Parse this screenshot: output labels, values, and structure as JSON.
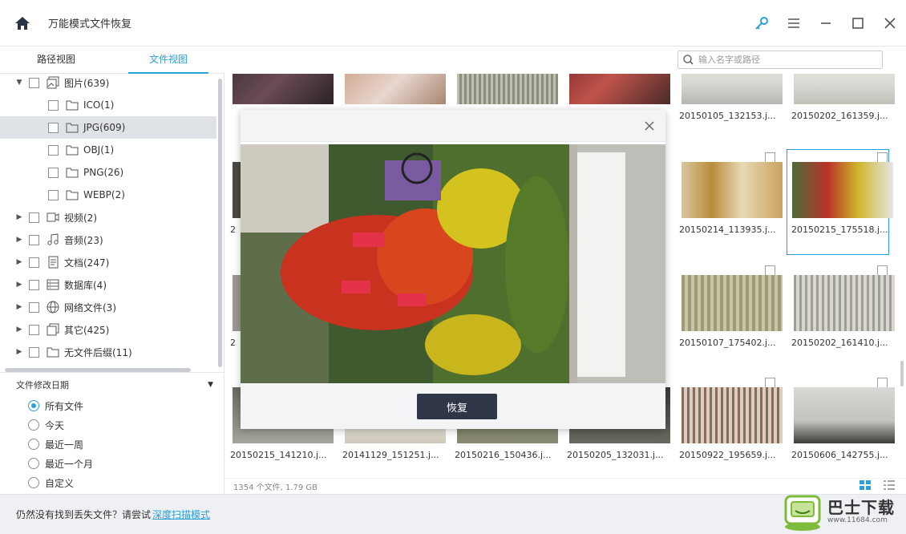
{
  "app": {
    "title": "万能模式文件恢复",
    "icons": [
      "home-icon",
      "key-icon",
      "menu-icon",
      "minimize-icon",
      "maximize-icon",
      "close-icon"
    ],
    "accent_color": "#2a9fd8"
  },
  "tabs": [
    {
      "label": "路径视图",
      "active": false
    },
    {
      "label": "文件视图",
      "active": true
    }
  ],
  "search": {
    "placeholder": "输入名字或路径"
  },
  "tree": [
    {
      "label": "图片(639)",
      "icon": "image-icon",
      "expanded": true
    },
    {
      "label": "ICO(1)",
      "icon": "folder-icon"
    },
    {
      "label": "JPG(609)",
      "icon": "folder-icon",
      "selected": true
    },
    {
      "label": "OBJ(1)",
      "icon": "folder-icon"
    },
    {
      "label": "PNG(26)",
      "icon": "folder-icon"
    },
    {
      "label": "WEBP(2)",
      "icon": "folder-icon"
    },
    {
      "label": "视频(2)",
      "icon": "video-icon"
    },
    {
      "label": "音频(23)",
      "icon": "music-icon"
    },
    {
      "label": "文档(247)",
      "icon": "document-icon"
    },
    {
      "label": "数据库(4)",
      "icon": "database-icon"
    },
    {
      "label": "网络文件(3)",
      "icon": "globe-icon"
    },
    {
      "label": "其它(425)",
      "icon": "other-icon"
    },
    {
      "label": "无文件后缀(11)",
      "icon": "folder-icon"
    }
  ],
  "filter": {
    "title": "文件修改日期",
    "options": [
      "所有文件",
      "今天",
      "最近一周",
      "最近一个月",
      "自定义"
    ],
    "selected": "所有文件"
  },
  "files": {
    "row1": [
      "",
      "",
      "",
      "",
      "20150105_132153.j...",
      "20150202_161359.j..."
    ],
    "row2": [
      "20150214_113935.j...",
      "20150215_175518.j..."
    ],
    "row3": [
      "20150107_175402.j...",
      "20150202_161410.j..."
    ],
    "row4": [
      "20150215_141210.j...",
      "20141129_151251.j...",
      "20150216_150436.j...",
      "20150205_132031.j...",
      "20150922_195659.j...",
      "20150606_142755.j..."
    ],
    "partial_label": "2"
  },
  "status": {
    "summary": "1354 个文件, 1.79 GB"
  },
  "bottom": {
    "text": "仍然没有找到丢失文件？请尝试",
    "link": "深度扫描模式"
  },
  "modal": {
    "recover_label": "恢复"
  },
  "watermark": {
    "title": "巴士下载",
    "url": "www.11684.com"
  }
}
